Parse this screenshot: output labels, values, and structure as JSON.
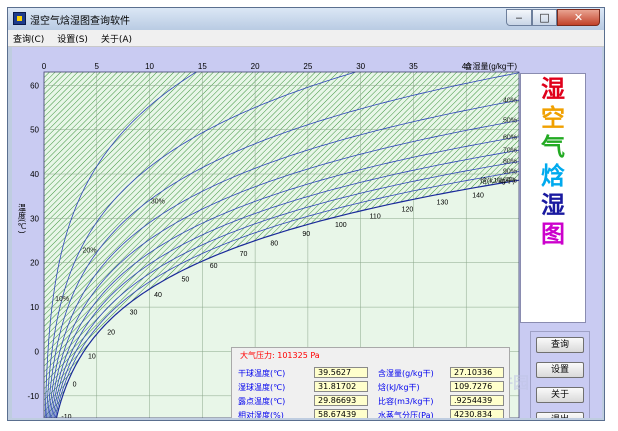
{
  "window": {
    "title": "湿空气焓湿图查询软件",
    "controls": {
      "minimize": "‒",
      "maximize": "□",
      "close": "✕"
    },
    "icon": "app-icon"
  },
  "menu": [
    {
      "label": "查询(C)"
    },
    {
      "label": "设置(S)"
    },
    {
      "label": "关于(A)"
    }
  ],
  "side_title": [
    "湿",
    "空",
    "气",
    "焓",
    "湿",
    "图"
  ],
  "side_colors": [
    "#e0001b",
    "#f0a000",
    "#22aa22",
    "#00aaee",
    "#1a1aa0",
    "#cc00cc"
  ],
  "buttons": [
    {
      "label": "查询"
    },
    {
      "label": "设置"
    },
    {
      "label": "关于"
    },
    {
      "label": "退出"
    }
  ],
  "info": {
    "pressure_label": "大气压力:",
    "pressure_value": "101325 Pa",
    "fields": [
      {
        "label": "干球温度(℃)",
        "value": "39.5627"
      },
      {
        "label": "含湿量(g/kg干)",
        "value": "27.10336"
      },
      {
        "label": "湿球温度(℃)",
        "value": "31.81702"
      },
      {
        "label": "焓(kJ/kg干)",
        "value": "109.7276"
      },
      {
        "label": "露点温度(℃)",
        "value": "29.86693"
      },
      {
        "label": "比容(m3/kg干)",
        "value": ".9254439"
      },
      {
        "label": "相对湿度(%)",
        "value": "58.67439"
      },
      {
        "label": "水蒸气分压(Pa)",
        "value": "4230.834"
      }
    ]
  },
  "chart_data": {
    "type": "psychrometric",
    "x_axis": {
      "label": "含湿量(g/kg干)",
      "range": [
        0,
        45
      ],
      "ticks": [
        0,
        5,
        10,
        15,
        20,
        25,
        30,
        35,
        40
      ]
    },
    "y_axis": {
      "label": "温度(℃)",
      "range": [
        -15,
        63
      ],
      "ticks": [
        -10,
        0,
        10,
        20,
        30,
        40,
        50,
        60
      ]
    },
    "relative_humidity_lines": [
      10,
      20,
      30,
      40,
      50,
      60,
      70,
      80,
      90,
      100
    ],
    "rh_labels": [
      "10%",
      "20%",
      "30%",
      "40%",
      "50%",
      "60%",
      "70%",
      "80%",
      "90%",
      "100%"
    ],
    "enthalpy_ticks": [
      -10,
      0,
      10,
      20,
      30,
      40,
      50,
      60,
      70,
      80,
      90,
      100,
      110,
      120,
      130,
      140
    ],
    "enthalpy_label": "焓(kJ/kg干)",
    "pressure_pa": 101325,
    "grid": true,
    "hatched_background": true
  },
  "watermark": "当下软件园"
}
